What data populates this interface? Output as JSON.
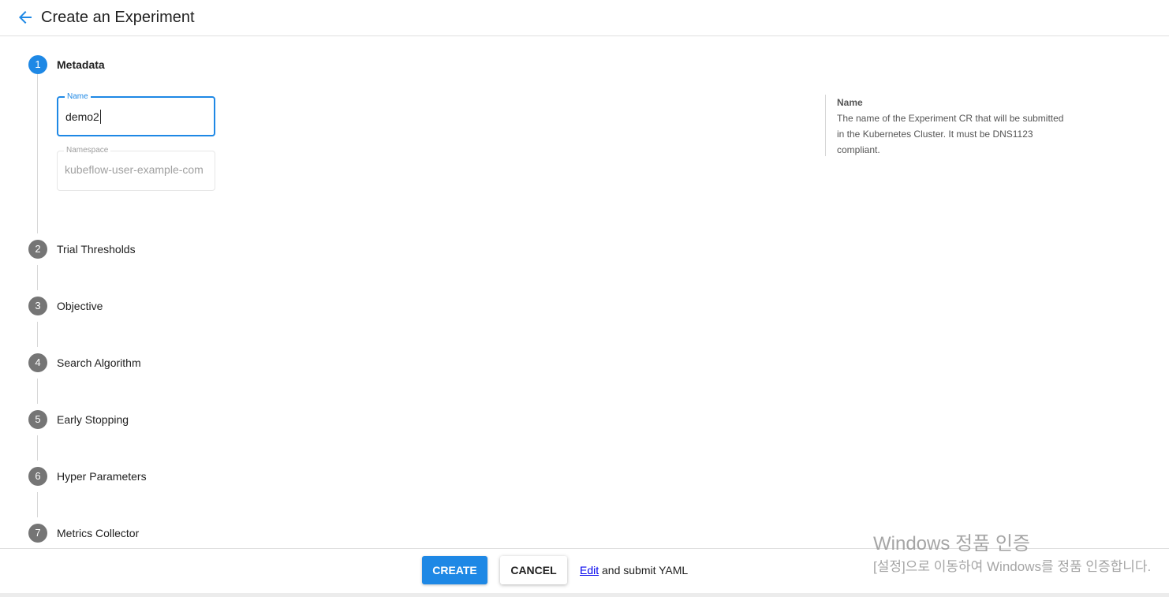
{
  "header": {
    "back_icon": "arrow-left-icon",
    "title": "Create an Experiment"
  },
  "colors": {
    "accent": "#1e88e5",
    "step_inactive": "#757575"
  },
  "steps": [
    {
      "number": "1",
      "label": "Metadata",
      "active": true
    },
    {
      "number": "2",
      "label": "Trial Thresholds",
      "active": false
    },
    {
      "number": "3",
      "label": "Objective",
      "active": false
    },
    {
      "number": "4",
      "label": "Search Algorithm",
      "active": false
    },
    {
      "number": "5",
      "label": "Early Stopping",
      "active": false
    },
    {
      "number": "6",
      "label": "Hyper Parameters",
      "active": false
    },
    {
      "number": "7",
      "label": "Metrics Collector",
      "active": false
    }
  ],
  "metadata": {
    "name": {
      "label": "Name",
      "value": "demo2"
    },
    "namespace": {
      "label": "Namespace",
      "value": "kubeflow-user-example-com"
    }
  },
  "help": {
    "title": "Name",
    "text": "The name of the Experiment CR that will be submitted in the Kubernetes Cluster. It must be DNS1123 compliant."
  },
  "footer": {
    "create_label": "CREATE",
    "cancel_label": "CANCEL",
    "edit_link": "Edit",
    "yaml_text": " and submit YAML"
  },
  "watermark": {
    "title": "Windows 정품 인증",
    "subtitle": "[설정]으로 이동하여 Windows를 정품 인증합니다."
  }
}
